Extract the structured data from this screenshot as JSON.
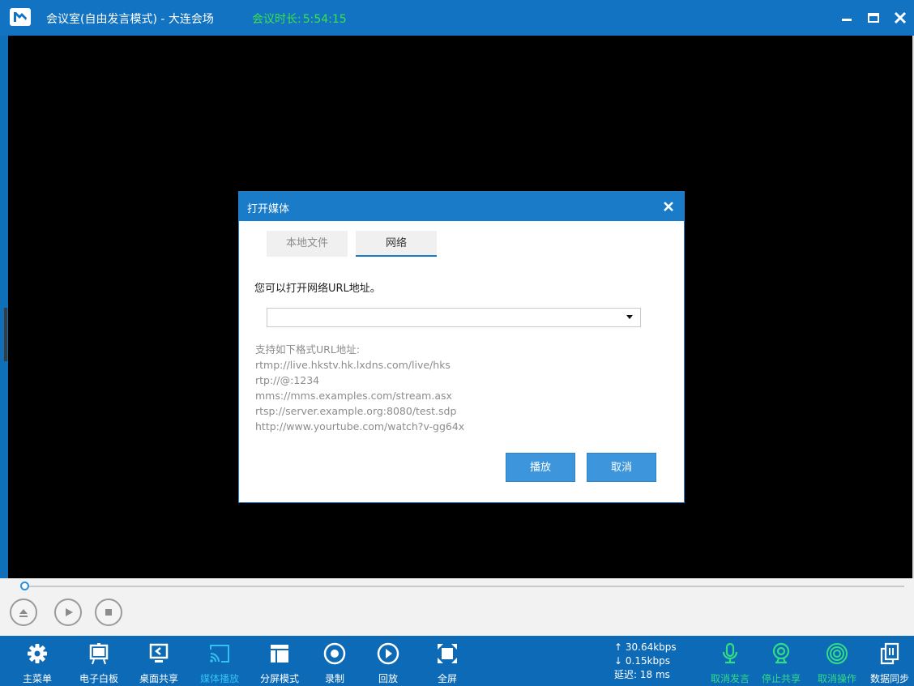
{
  "window": {
    "title": "会议室(自由发言模式) - 大连会场",
    "duration_label": "会议时长:",
    "duration_value": "5:54:15"
  },
  "dialog": {
    "title": "打开媒体",
    "tabs": [
      {
        "label": "本地文件",
        "selected": false
      },
      {
        "label": "网络",
        "selected": true
      }
    ],
    "instruction": "您可以打开网络URL地址。",
    "url_value": "",
    "formats_header": "支持如下格式URL地址:",
    "formats": [
      "rtmp://live.hkstv.hk.lxdns.com/live/hks",
      "rtp://@:1234",
      "mms://mms.examples.com/stream.asx",
      "rtsp://server.example.org:8080/test.sdp",
      "http://www.yourtube.com/watch?v-gg64x"
    ],
    "play_button": "播放",
    "cancel_button": "取消"
  },
  "playback": {
    "progress": 0
  },
  "toolbar": {
    "items": [
      {
        "label": "主菜单",
        "icon": "gear-icon"
      },
      {
        "label": "电子白板",
        "icon": "whiteboard-icon"
      },
      {
        "label": "桌面共享",
        "icon": "desktop-share-icon"
      },
      {
        "label": "媒体播放",
        "icon": "cast-icon",
        "active": true
      },
      {
        "label": "分屏模式",
        "icon": "split-screen-icon"
      },
      {
        "label": "录制",
        "icon": "record-icon"
      },
      {
        "label": "回放",
        "icon": "replay-icon"
      },
      {
        "label": "全屏",
        "icon": "fullscreen-icon"
      }
    ],
    "right_items": [
      {
        "label": "取消发言",
        "icon": "microphone-icon"
      },
      {
        "label": "停止共享",
        "icon": "webcam-icon"
      },
      {
        "label": "取消操作",
        "icon": "operation-icon"
      },
      {
        "label": "数据同步",
        "icon": "data-sync-icon"
      }
    ],
    "net": {
      "upload": "↑ 30.64kbps",
      "download": "↓ 0.15kbps",
      "latency": "延迟: 18 ms"
    }
  },
  "colors": {
    "titlebar": "#1273c2",
    "toolbar": "#0d6ab6",
    "accent_green": "#3ce14a",
    "active_cyan": "#33c1f2"
  }
}
